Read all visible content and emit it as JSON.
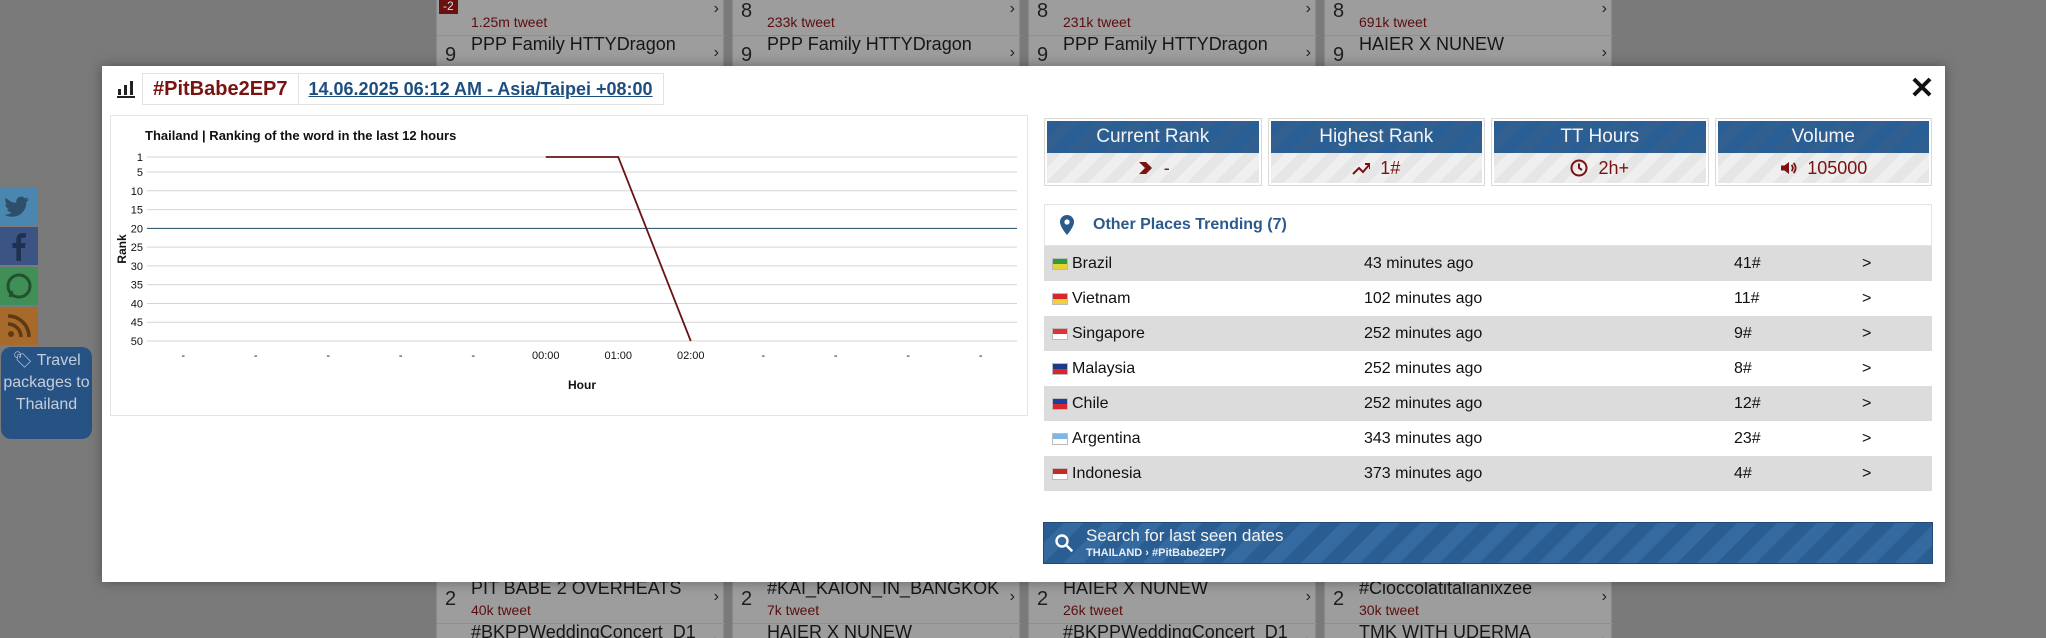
{
  "background": {
    "columns": [
      {
        "rows": [
          {
            "num": "",
            "name": "",
            "sub": "1.25m tweet",
            "badge": "-2",
            "top": -24
          },
          {
            "num": "9",
            "name": "PPP Family HTTYDragon",
            "sub": "",
            "badge": ""
          },
          {
            "num": "2",
            "name": "PIT BABE 2 OVERHEATS",
            "sub": "40k tweet",
            "badge": ""
          },
          {
            "num": "",
            "name": "#BKPPWeddingConcert_D1",
            "sub": "",
            "badge": ""
          }
        ]
      },
      {
        "rows": [
          {
            "num": "8",
            "name": "",
            "sub": "233k tweet",
            "badge": ""
          },
          {
            "num": "9",
            "name": "PPP Family HTTYDragon",
            "sub": "",
            "badge": ""
          },
          {
            "num": "2",
            "name": "#KAI_KAION_IN_BANGKOK",
            "sub": "7k tweet",
            "badge": ""
          },
          {
            "num": "",
            "name": "HAIER X NUNEW",
            "sub": "",
            "badge": ""
          }
        ]
      },
      {
        "rows": [
          {
            "num": "8",
            "name": "",
            "sub": "231k tweet",
            "badge": ""
          },
          {
            "num": "9",
            "name": "PPP Family HTTYDragon",
            "sub": "",
            "badge": ""
          },
          {
            "num": "2",
            "name": "HAIER X NUNEW",
            "sub": "26k tweet",
            "badge": ""
          },
          {
            "num": "",
            "name": "#BKPPWeddingConcert_D1",
            "sub": "",
            "badge": ""
          }
        ]
      },
      {
        "rows": [
          {
            "num": "8",
            "name": "",
            "sub": "691k tweet",
            "badge": ""
          },
          {
            "num": "9",
            "name": "HAIER X NUNEW",
            "sub": "",
            "badge": ""
          },
          {
            "num": "2",
            "name": "#Cioccolatitalianixzee",
            "sub": "30k tweet",
            "badge": ""
          },
          {
            "num": "",
            "name": "TMK WITH UDERMA",
            "sub": "",
            "badge": ""
          }
        ]
      }
    ],
    "travel_label": "Travel packages to Thailand"
  },
  "modal": {
    "hashtag": "#PitBabe2EP7",
    "date": "14.06.2025 06:12 AM - Asia/Taipei +08:00",
    "close_label": "✕",
    "stats": [
      {
        "title": "Current Rank",
        "value": "-",
        "icon": "chevron-right-icon"
      },
      {
        "title": "Highest Rank",
        "value": "1#",
        "icon": "trend-up-icon"
      },
      {
        "title": "TT Hours",
        "value": "2h+",
        "icon": "clock-icon"
      },
      {
        "title": "Volume",
        "value": "105000",
        "icon": "speaker-icon"
      }
    ],
    "places_title": "Other Places Trending (7)",
    "places": [
      {
        "country": "Brazil",
        "time": "43 minutes ago",
        "rank": "41#",
        "arrow": ">",
        "flag": [
          "#2f9a3a",
          "#e8d23a"
        ]
      },
      {
        "country": "Vietnam",
        "time": "102 minutes ago",
        "rank": "11#",
        "arrow": ">",
        "flag": [
          "#d8262b",
          "#f2d03a"
        ]
      },
      {
        "country": "Singapore",
        "time": "252 minutes ago",
        "rank": "9#",
        "arrow": ">",
        "flag": [
          "#e0303a",
          "#ffffff"
        ]
      },
      {
        "country": "Malaysia",
        "time": "252 minutes ago",
        "rank": "8#",
        "arrow": ">",
        "flag": [
          "#1b3a8a",
          "#d8262b"
        ]
      },
      {
        "country": "Chile",
        "time": "252 minutes ago",
        "rank": "12#",
        "arrow": ">",
        "flag": [
          "#1d3e9a",
          "#d8262b"
        ]
      },
      {
        "country": "Argentina",
        "time": "343 minutes ago",
        "rank": "23#",
        "arrow": ">",
        "flag": [
          "#7cb7e8",
          "#ffffff"
        ]
      },
      {
        "country": "Indonesia",
        "time": "373 minutes ago",
        "rank": "4#",
        "arrow": ">",
        "flag": [
          "#c62828",
          "#ffffff"
        ]
      }
    ],
    "search_title": "Search for last seen dates",
    "search_sub": "THAILAND › #PitBabe2EP7"
  },
  "chart_data": {
    "type": "line",
    "title": "Thailand | Ranking of the word in the last 12 hours",
    "xlabel": "Hour",
    "ylabel": "Rank",
    "categories": [
      "-",
      "-",
      "-",
      "-",
      "-",
      "00:00",
      "01:00",
      "02:00",
      "-",
      "-",
      "-",
      "-"
    ],
    "y_ticks": [
      1,
      5,
      10,
      15,
      20,
      25,
      30,
      35,
      40,
      45,
      50
    ],
    "ylim": [
      1,
      50
    ],
    "y_inverted": true,
    "reference_line": 20,
    "series": [
      {
        "values": [
          null,
          null,
          null,
          null,
          null,
          1,
          1,
          50,
          null,
          null,
          null,
          null
        ]
      }
    ],
    "line_color": "#6a1414",
    "grid": true
  }
}
